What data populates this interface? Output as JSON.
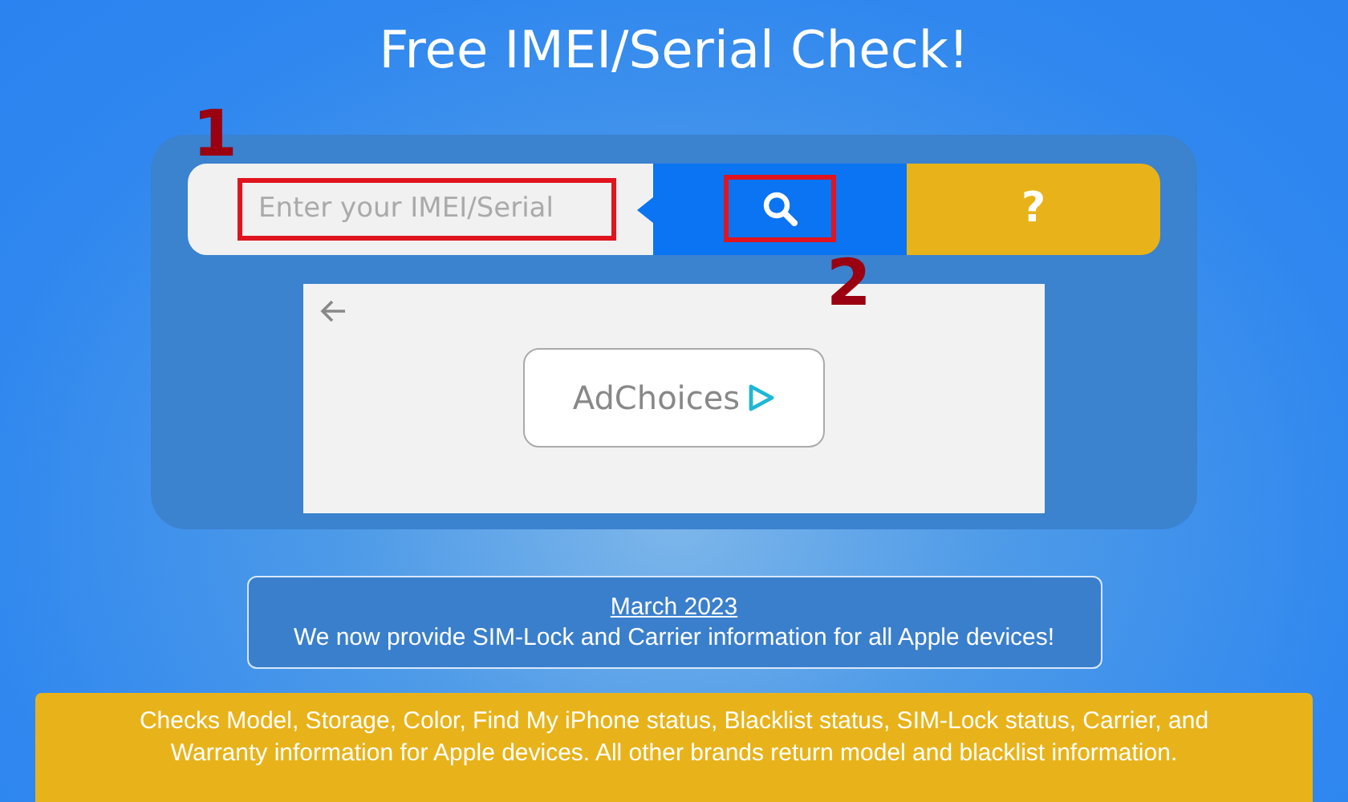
{
  "title": "Free IMEI/Serial Check!",
  "search": {
    "placeholder": "Enter your IMEI/Serial",
    "highlighted": true,
    "marker": "1"
  },
  "search_button": {
    "highlighted": true,
    "marker": "2"
  },
  "help_button": {
    "label": "?"
  },
  "ad": {
    "label": "AdChoices"
  },
  "notice": {
    "date": "March 2023",
    "text": "We now provide SIM-Lock and Carrier information for all Apple devices!"
  },
  "info": "Checks Model, Storage, Color, Find My iPhone status, Blacklist status, SIM-Lock status, Carrier, and Warranty information for Apple devices. All other brands return model and blacklist information."
}
